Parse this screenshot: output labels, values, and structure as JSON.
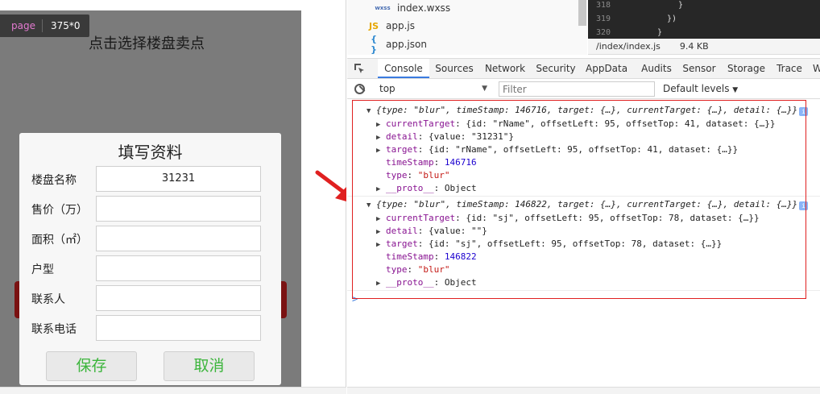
{
  "simulator": {
    "page_tag_key": "page",
    "page_tag_value": "375*0",
    "page_title": "点击选择楼盘卖点",
    "dialog": {
      "title": "填写资料",
      "fields": [
        {
          "label": "楼盘名称",
          "value": "31231"
        },
        {
          "label": "售价（万）",
          "value": ""
        },
        {
          "label": "面积（㎡）",
          "value": ""
        },
        {
          "label": "户型",
          "value": ""
        },
        {
          "label": "联系人",
          "value": ""
        },
        {
          "label": "联系电话",
          "value": ""
        }
      ],
      "save_label": "保存",
      "cancel_label": "取消"
    }
  },
  "file_tree": [
    {
      "icon": "wxss",
      "name": "index.wxss"
    },
    {
      "icon": "JS",
      "name": "app.js"
    },
    {
      "icon": "{ }",
      "name": "app.json"
    }
  ],
  "code_editor": {
    "lines": [
      {
        "num": "318",
        "text": "}"
      },
      {
        "num": "319",
        "text": "})"
      },
      {
        "num": "320",
        "text": "}"
      }
    ],
    "file_path": "/index/index.js",
    "file_size": "9.4 KB"
  },
  "tabs": [
    "Console",
    "Sources",
    "Network",
    "Security",
    "AppData",
    "Audits",
    "Sensor",
    "Storage",
    "Trace",
    "W"
  ],
  "active_tab": "Console",
  "filter_bar": {
    "context": "top",
    "filter_placeholder": "Filter",
    "levels": "Default levels"
  },
  "console_entries": [
    {
      "summary": "{type: \"blur\", timeStamp: 146716, target: {…}, currentTarget: {…}, detail: {…}}",
      "props": [
        {
          "name": "currentTarget",
          "value": "{id: \"rName\", offsetLeft: 95, offsetTop: 41, dataset: {…}}",
          "expandable": true
        },
        {
          "name": "detail",
          "value": "{value: \"31231\"}",
          "expandable": true
        },
        {
          "name": "target",
          "value": "{id: \"rName\", offsetLeft: 95, offsetTop: 41, dataset: {…}}",
          "expandable": true
        },
        {
          "name": "timeStamp",
          "value": "146716",
          "expandable": false
        },
        {
          "name": "type",
          "value": "\"blur\"",
          "expandable": false
        },
        {
          "name": "__proto__",
          "value": "Object",
          "expandable": true
        }
      ]
    },
    {
      "summary": "{type: \"blur\", timeStamp: 146822, target: {…}, currentTarget: {…}, detail: {…}}",
      "props": [
        {
          "name": "currentTarget",
          "value": "{id: \"sj\", offsetLeft: 95, offsetTop: 78, dataset: {…}}",
          "expandable": true
        },
        {
          "name": "detail",
          "value": "{value: \"\"}",
          "expandable": true
        },
        {
          "name": "target",
          "value": "{id: \"sj\", offsetLeft: 95, offsetTop: 78, dataset: {…}}",
          "expandable": true
        },
        {
          "name": "timeStamp",
          "value": "146822",
          "expandable": false
        },
        {
          "name": "type",
          "value": "\"blur\"",
          "expandable": false
        },
        {
          "name": "__proto__",
          "value": "Object",
          "expandable": true
        }
      ]
    }
  ],
  "prompt": ">",
  "colors": {
    "annotation_red": "#e02020",
    "save_green": "#3cb53c",
    "active_tab_blue": "#3a7be0"
  }
}
